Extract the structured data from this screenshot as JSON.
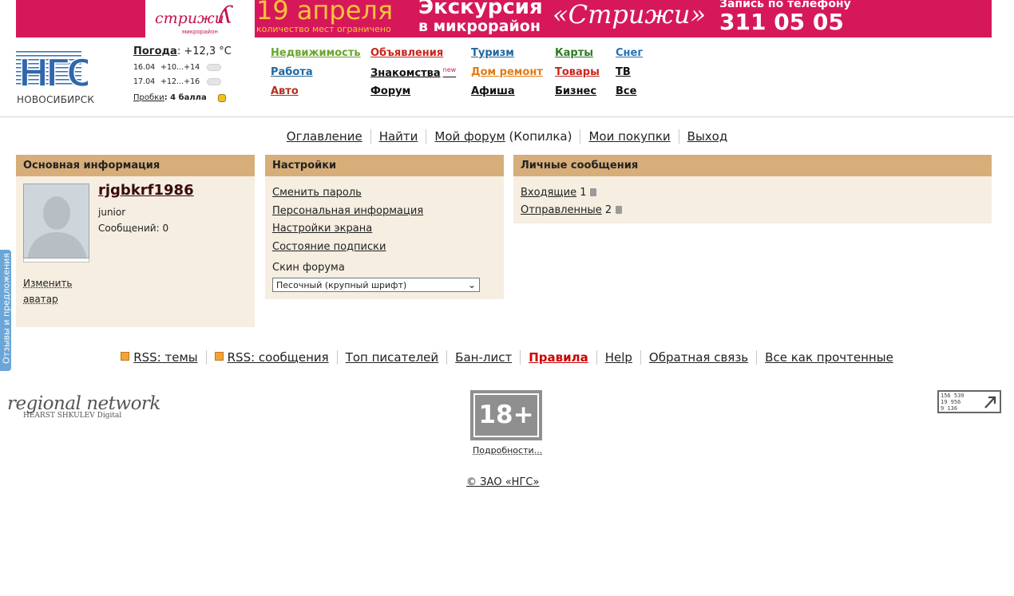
{
  "banner": {
    "logo_script": "стрижи",
    "logo_sub": "микрорайон",
    "date": "19 апреля",
    "date_note": "количество мест ограничено",
    "excursion_line1": "Экскурсия",
    "excursion_line2": "в микрорайон",
    "brand": "«Стрижи»",
    "call_label": "Запись по телефону",
    "phone": "311 05 05"
  },
  "header": {
    "city": "НОВОСИБИРСК",
    "weather": {
      "title": "Погода",
      "current": ": +12,3 °C",
      "rows": [
        {
          "date": "16.04",
          "temp": "+10...+14"
        },
        {
          "date": "17.04",
          "temp": "+12...+16"
        }
      ],
      "traffic_label": "Пробки",
      "traffic_value": ": 4 балла"
    },
    "nav": {
      "realty": "Недвижимость",
      "ads": "Объявления",
      "tourism": "Туризм",
      "maps": "Карты",
      "snow": "Снег",
      "jobs": "Работа",
      "dating": "Знакомства",
      "dating_badge": "new",
      "home": "Дом ремонт",
      "goods": "Товары",
      "tv": "ТВ",
      "auto": "Авто",
      "forum": "Форум",
      "afisha": "Афиша",
      "business": "Бизнес",
      "all": "Все"
    }
  },
  "forum_menu": {
    "contents": "Оглавление",
    "find": "Найти",
    "my_forum": "Мой форум",
    "piggy": " (Копилка)",
    "purchases": "Мои покупки",
    "logout": "Выход"
  },
  "main_info": {
    "header": "Основная информация",
    "username": "rjgbkrf1986",
    "rank": "junior",
    "posts": "Сообщений: 0",
    "change": "Изменить",
    "avatar_link": "аватар"
  },
  "settings": {
    "header": "Настройки",
    "links": [
      "Сменить пароль",
      "Персональная информация",
      "Настройки экрана",
      "Состояние подписки"
    ],
    "skin_label": "Скин форума",
    "skin_value": "Песочный (крупный шрифт)"
  },
  "pm": {
    "header": "Личные сообщения",
    "inbox": "Входящие",
    "inbox_count": " 1",
    "sent": "Отправленные",
    "sent_count": " 2"
  },
  "footer": {
    "rss_topics": "RSS: темы",
    "rss_messages": "RSS: сообщения",
    "top_writers": "Топ писателей",
    "ban_list": "Бан-лист",
    "rules": "Правила",
    "help": "Help",
    "feedback": "Обратная связь",
    "mark_read": "Все как прочтенные",
    "regional": "regional network",
    "regional_sub": "HEARST SHKULEV Digital",
    "age": "18+",
    "details": "Подробности...",
    "copyright": "© ЗАО «НГС»",
    "counter": [
      "156 539",
      "19 956",
      "9 136"
    ]
  },
  "feedback_tab": "Отзывы и предложения",
  "colors": {
    "banner": "#d6185a",
    "panel_header": "#d7ae79",
    "panel_bg": "#f5eee1",
    "rules": "#cc0000"
  }
}
